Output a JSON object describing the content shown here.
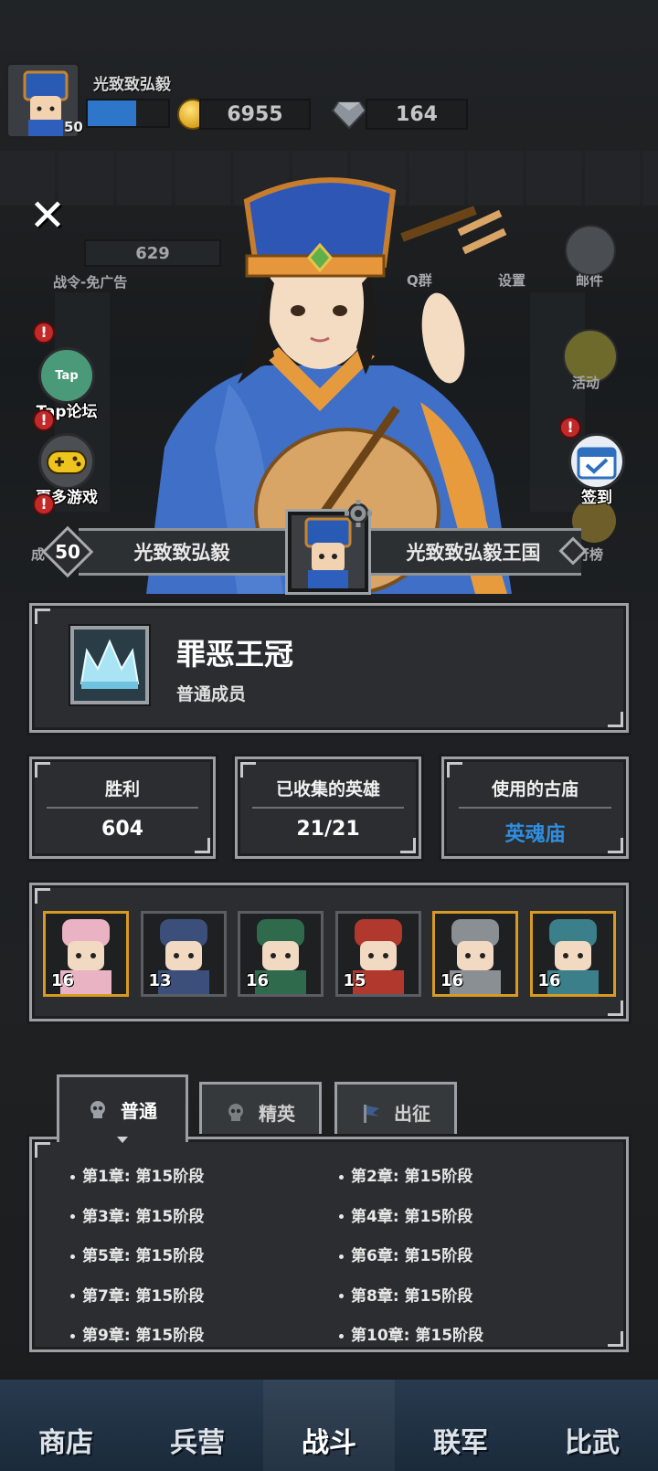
{
  "player": {
    "name": "光致致弘毅",
    "level": "50",
    "xp_fraction": 0.6,
    "gold": "6955",
    "gems": "164"
  },
  "background_ui": {
    "pass_value": "629",
    "pass_label": "战令-免广告",
    "qq_label": "Q群",
    "settings_label": "设置",
    "mail_label": "邮件",
    "activity_label": "活动",
    "ranking_label": "行榜",
    "achievement_label": "成"
  },
  "side_left": {
    "tap_icon_text": "Tap",
    "tap_label": "Tap论坛",
    "games_label": "更多游戏"
  },
  "side_right": {
    "checkin_label": "签到"
  },
  "badges": {
    "alert": "!"
  },
  "banner": {
    "level": "50",
    "player_name": "光致致弘毅",
    "kingdom_name": "光致致弘毅王国"
  },
  "guild": {
    "name": "罪恶王冠",
    "role": "普通成员"
  },
  "stats": [
    {
      "title": "胜利",
      "value": "604"
    },
    {
      "title": "已收集的英雄",
      "value": "21/21"
    },
    {
      "title": "使用的古庙",
      "value": "英魂庙"
    }
  ],
  "heroes": [
    {
      "level": "16",
      "rarity": "gold"
    },
    {
      "level": "13",
      "rarity": "normal"
    },
    {
      "level": "16",
      "rarity": "normal"
    },
    {
      "level": "15",
      "rarity": "normal"
    },
    {
      "level": "16",
      "rarity": "gold"
    },
    {
      "level": "16",
      "rarity": "gold"
    }
  ],
  "tabs": [
    {
      "label": "普通",
      "icon": "skull-icon",
      "active": true
    },
    {
      "label": "精英",
      "icon": "skull-icon",
      "active": false
    },
    {
      "label": "出征",
      "icon": "flag-icon",
      "active": false
    }
  ],
  "chapters": [
    "第1章: 第15阶段",
    "第2章: 第15阶段",
    "第3章: 第15阶段",
    "第4章: 第15阶段",
    "第5章: 第15阶段",
    "第6章: 第15阶段",
    "第7章: 第15阶段",
    "第8章: 第15阶段",
    "第9章: 第15阶段",
    "第10章: 第15阶段"
  ],
  "bottom_nav": [
    {
      "label": "商店"
    },
    {
      "label": "兵营"
    },
    {
      "label": "战斗",
      "active": true
    },
    {
      "label": "联军"
    },
    {
      "label": "比武"
    }
  ],
  "colors": {
    "temple_text": "#2f8ee0",
    "hero_gold_border": "#d79a22",
    "panel_border": "#9ca0a4"
  }
}
